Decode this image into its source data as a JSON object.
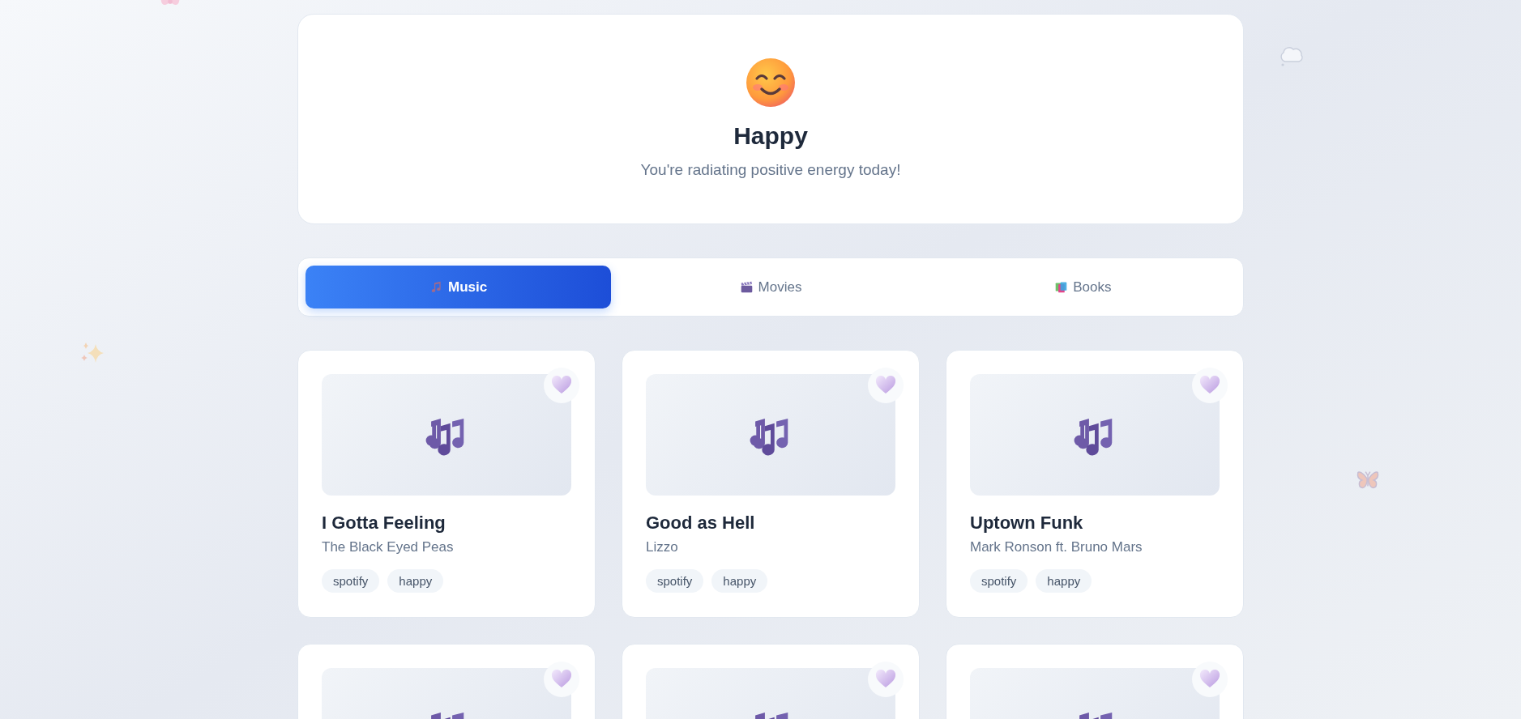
{
  "mood": {
    "kind": "happy",
    "title": "Happy",
    "message": "You're radiating positive energy today!"
  },
  "tabs": [
    {
      "kind": "music",
      "label": "Music",
      "selected": true
    },
    {
      "kind": "movies",
      "label": "Movies",
      "selected": false
    },
    {
      "kind": "books",
      "label": "Books",
      "selected": false
    }
  ],
  "cards": [
    {
      "kind": "music",
      "title": "I Gotta Feeling",
      "artist": "The Black Eyed Peas",
      "tags": [
        "spotify",
        "happy"
      ]
    },
    {
      "kind": "music",
      "title": "Good as Hell",
      "artist": "Lizzo",
      "tags": [
        "spotify",
        "happy"
      ]
    },
    {
      "kind": "music",
      "title": "Uptown Funk",
      "artist": "Mark Ronson ft. Bruno Mars",
      "tags": [
        "spotify",
        "happy"
      ]
    },
    {
      "kind": "music"
    },
    {
      "kind": "music"
    },
    {
      "kind": "music"
    }
  ]
}
